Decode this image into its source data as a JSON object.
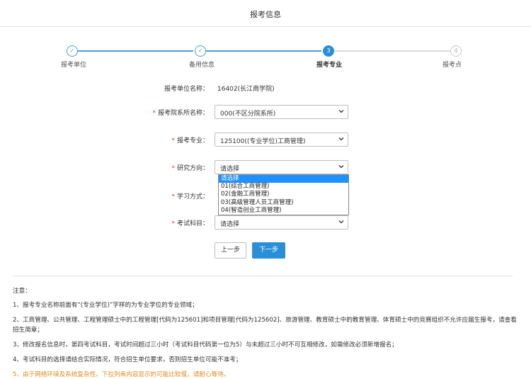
{
  "header": {
    "title": "报考信息"
  },
  "steps": [
    {
      "number": "✓",
      "label": "报考单位",
      "state": "done"
    },
    {
      "number": "✓",
      "label": "备用信息",
      "state": "done"
    },
    {
      "number": "3",
      "label": "报考专业",
      "state": "active"
    },
    {
      "number": "4",
      "label": "报考点",
      "state": "todo"
    }
  ],
  "form": {
    "unit": {
      "label": "报考单位名称：",
      "value": "16402(长江商学院)"
    },
    "department": {
      "label": "报考院系所名称：",
      "value": "000(不区分院系所)"
    },
    "major": {
      "label": "报考专业：",
      "value": "125100((专业学位)工商管理)"
    },
    "direction": {
      "label": "研究方向：",
      "value": "请选择"
    },
    "study_mode": {
      "label": "学习方式："
    },
    "exam_subjects": {
      "label": "考试科目：",
      "value": "请选择"
    }
  },
  "direction_options": [
    "请选择",
    "01(综合工商管理)",
    "02(金融工商管理)",
    "03(高级管理人员工商管理)",
    "04(智造创业工商管理)"
  ],
  "buttons": {
    "prev": "上一步",
    "next": "下一步"
  },
  "notes": {
    "title": "注意：",
    "items": [
      "1、报考专业名称前面有“(专业学位)”字样的为专业学位的专业领域；",
      "2、工商管理、公共管理、工程管理硕士中的工程管理[代码为125601]和项目管理[代码为125602]、旅游管理、教育硕士中的教育管理、体育硕士中的竞赛组织不允许应届生报考，请查看招生简章；",
      "3、修改报名信息时，第四考试科目，考试时间超过三小时（考试科目代码第一位为5）与未超过三小时不可互相修改，如需修改必须新增报名；",
      "4、考试科目的选择请结合实际情况，符合招生单位要求，否则招生单位可能不准考；",
      "5、由于网络环境及系统复杂性，下拉列表内容显示的可能比较慢，请耐心等待。"
    ]
  },
  "colors": {
    "primary": "#2b8fd8",
    "required": "#e0432b",
    "warning": "#e08a1e",
    "selected_option": "#1e90ff"
  }
}
